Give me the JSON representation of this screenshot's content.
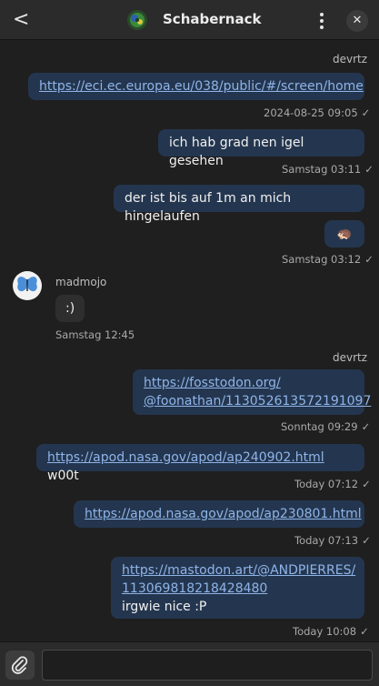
{
  "header": {
    "back_icon": "chevron-left-icon",
    "title": "Schabernack",
    "menu_icon": "vertical-dots-icon",
    "close_icon": "close-icon",
    "close_glyph": "✕",
    "back_glyph": "<"
  },
  "messages": [
    {
      "sender": "devrtz"
    },
    {
      "link": "https://eci.ec.europa.eu/038/public/#/screen/home",
      "time": "2024-08-25 09:05",
      "check": "✓"
    },
    {
      "text": "ich hab grad nen igel gesehen",
      "time": "Samstag 03:11",
      "check": "✓"
    },
    {
      "text": "der ist bis auf 1m an mich hingelaufen"
    },
    {
      "emoji": "🦔",
      "time": "Samstag 03:12",
      "check": "✓"
    },
    {
      "sender": "madmojo",
      "text": ":)",
      "time": "Samstag 12:45"
    },
    {
      "sender": "devrtz"
    },
    {
      "link_line1": "https://fosstodon.org/",
      "link_line2": "@foonathan/113052613572191097",
      "time": "Sonntag 09:29",
      "check": "✓"
    },
    {
      "link": "https://apod.nasa.gov/apod/ap240902.html",
      "text_after": " w00t",
      "time": "Today 07:12",
      "check": "✓"
    },
    {
      "link": "https://apod.nasa.gov/apod/ap230801.html",
      "time": "Today 07:13",
      "check": "✓"
    },
    {
      "link_line1": "https://mastodon.art/@ANDPIERRES/",
      "link_line2": "113069818218428480",
      "text": "irgwie nice :P",
      "time": "Today 10:08",
      "check": "✓"
    }
  ],
  "composer": {
    "attach_icon": "paperclip-icon",
    "placeholder": ""
  },
  "colors": {
    "own_bubble": "#24364f",
    "other_bubble": "#2e2e2e",
    "link": "#8fb4e8",
    "background": "#1f1f1f"
  }
}
